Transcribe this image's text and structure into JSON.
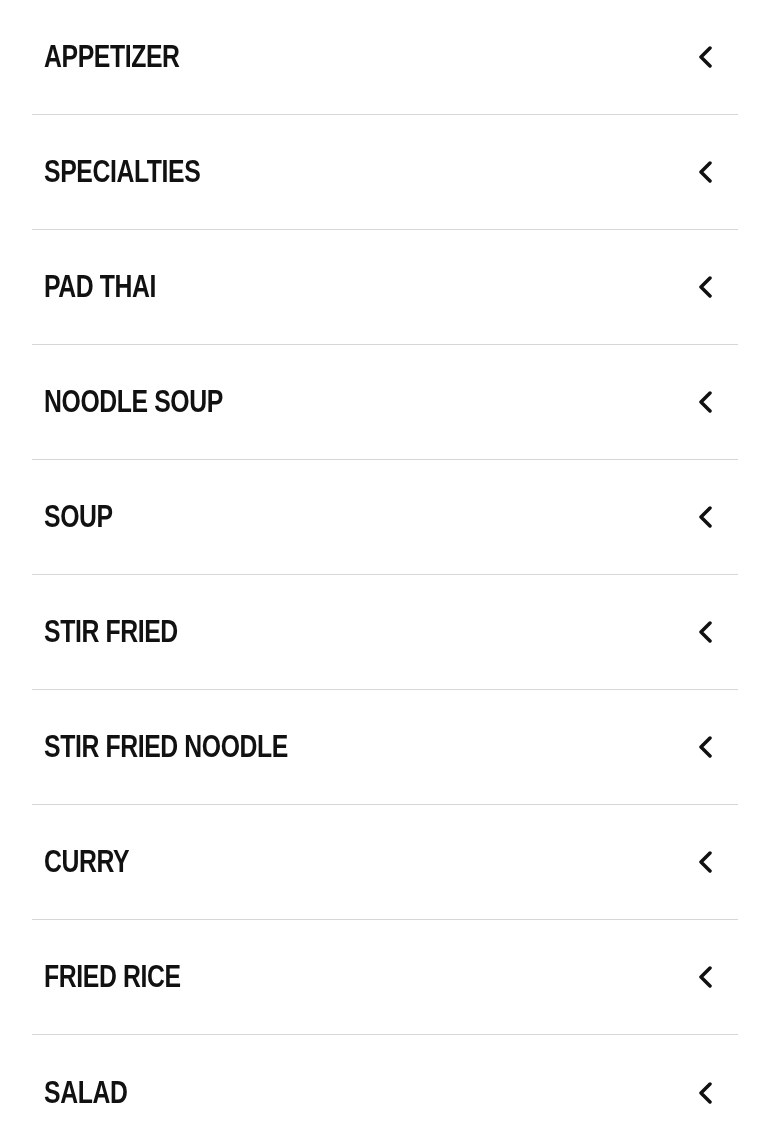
{
  "categories": [
    {
      "label": "APPETIZER",
      "expanded": false
    },
    {
      "label": "SPECIALTIES",
      "expanded": false
    },
    {
      "label": "PAD THAI",
      "expanded": false
    },
    {
      "label": "NOODLE SOUP",
      "expanded": false
    },
    {
      "label": "SOUP",
      "expanded": false
    },
    {
      "label": "STIR FRIED",
      "expanded": false
    },
    {
      "label": "STIR FRIED NOODLE",
      "expanded": false
    },
    {
      "label": "CURRY",
      "expanded": false
    },
    {
      "label": "FRIED RICE",
      "expanded": false
    },
    {
      "label": "SALAD",
      "expanded": false
    }
  ]
}
